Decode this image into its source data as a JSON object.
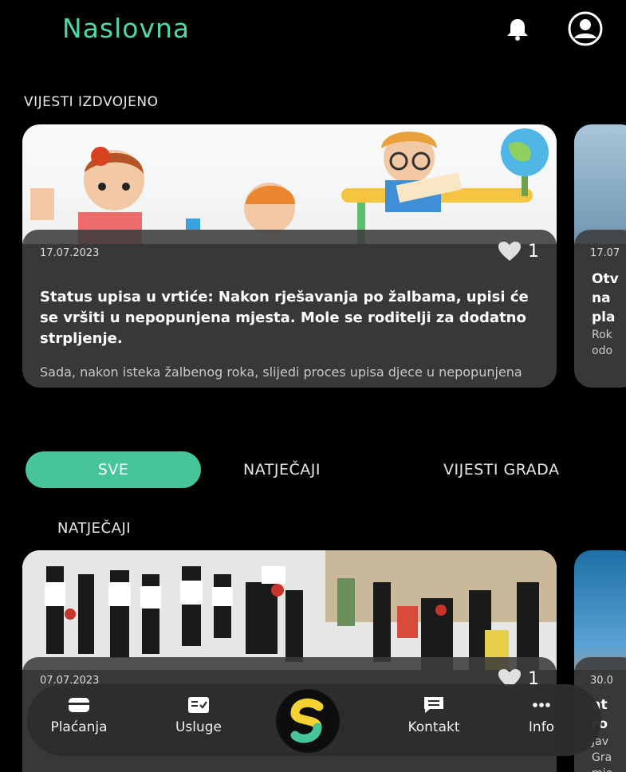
{
  "header": {
    "title": "Naslovna",
    "bell_icon": "bell-icon",
    "profile_icon": "user-circle-icon"
  },
  "featured": {
    "label": "VIJESTI IZDVOJENO",
    "cards": [
      {
        "date": "17.07.2023",
        "likes": "1",
        "headline": "Status upisa u vrtiće: Nakon rješavanja po žalbama, upisi će se vršiti u nepopunjena mjesta. Mole se roditelji za dodatno strpljenje.",
        "excerpt": "Sada, nakon isteka žalbenog roka, slijedi proces upisa djece u nepopunjena vrtićka i jaslička"
      },
      {
        "date": "17.07",
        "lines": [
          "Otv",
          "na",
          "pla",
          "Rok",
          "odo"
        ]
      }
    ]
  },
  "tabs": {
    "all": "SVE",
    "tenders": "NATJEČAJI",
    "city_news": "VIJESTI GRADA"
  },
  "list": {
    "label": "NATJEČAJI",
    "cards": [
      {
        "date": "07.07.2023",
        "likes": "1"
      },
      {
        "date": "30.0",
        "lines": [
          "at",
          "ro",
          "Jav",
          "Gra",
          "mje"
        ]
      }
    ]
  },
  "bottom_nav": {
    "payments": "Plaćanja",
    "services": "Usluge",
    "contact": "Kontakt",
    "info": "Info",
    "logo_icon": "app-logo-icon"
  },
  "colors": {
    "accent": "#46c59a",
    "title": "#4dd9a8",
    "nav_bg": "#2d2d2d"
  }
}
